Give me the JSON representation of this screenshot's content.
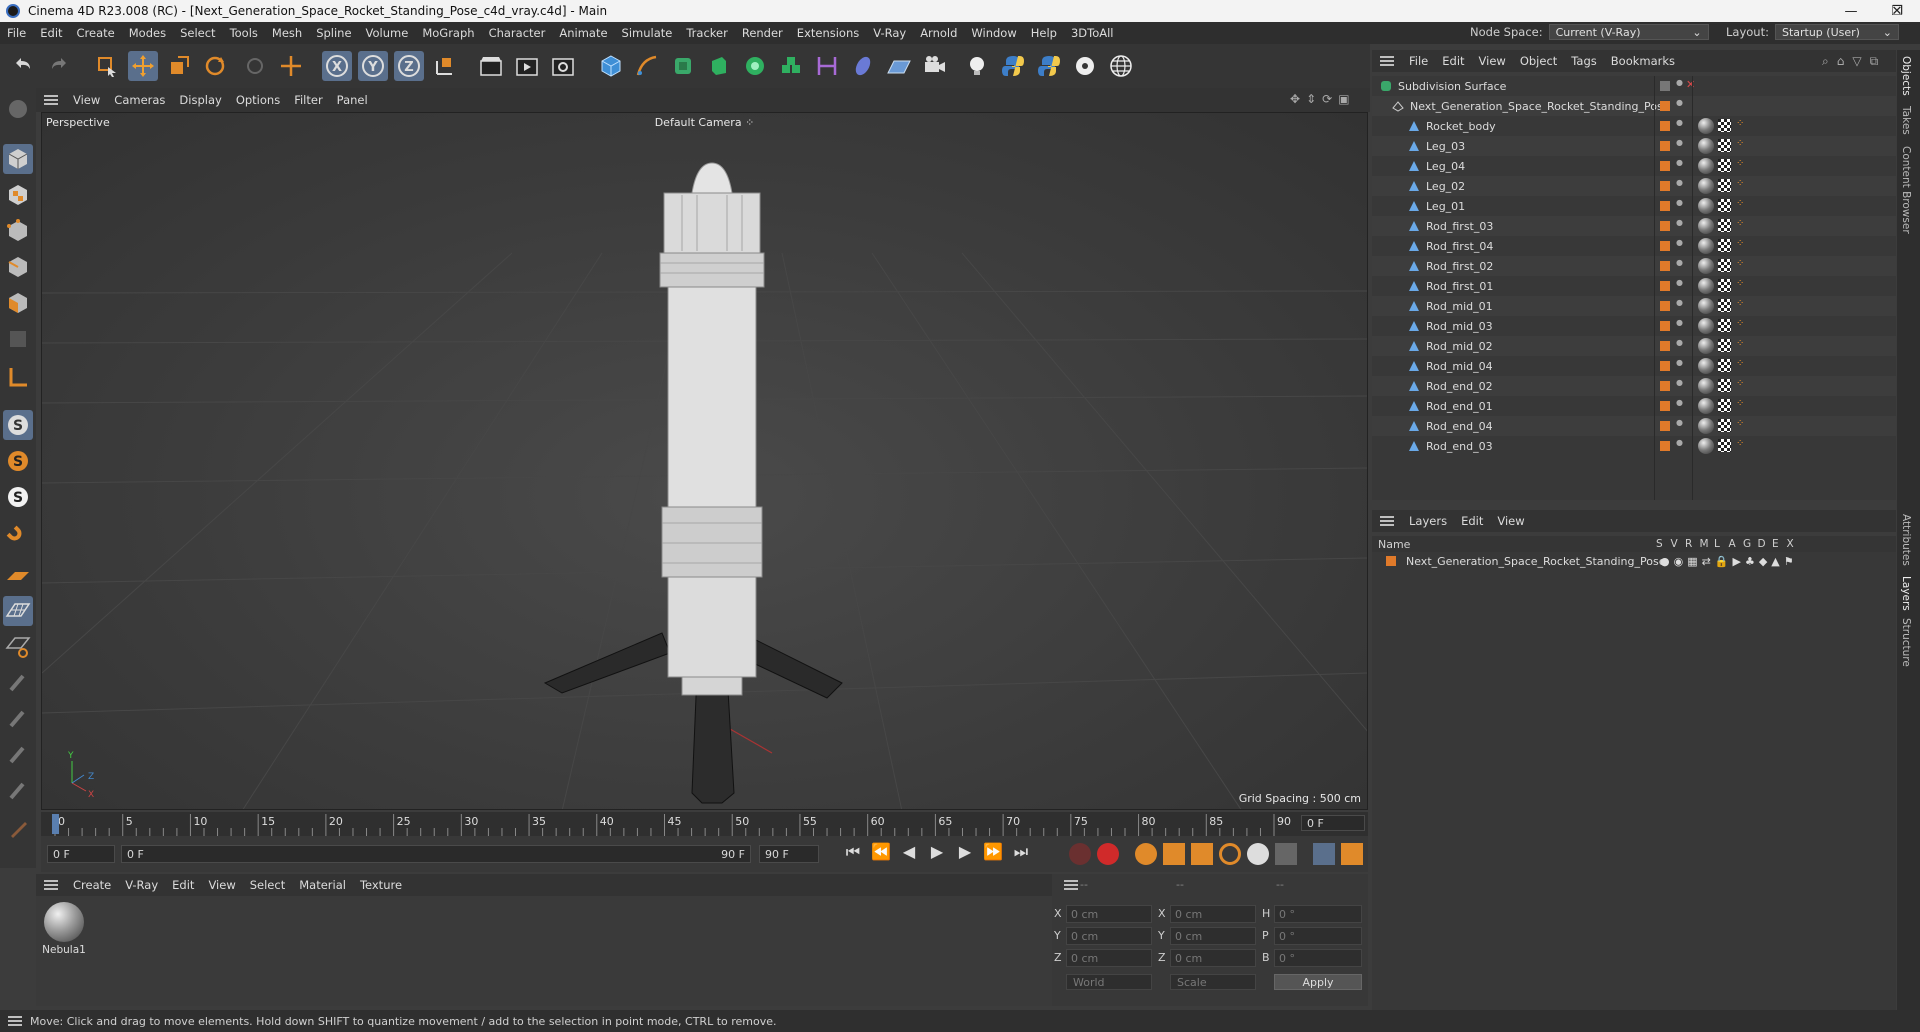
{
  "window": {
    "title": "Cinema 4D R23.008 (RC) - [Next_Generation_Space_Rocket_Standing_Pose_c4d_vray.c4d] - Main",
    "minimize": "—",
    "maximize": "❐",
    "close": "✕"
  },
  "menubar": {
    "items": [
      "File",
      "Edit",
      "Create",
      "Modes",
      "Select",
      "Tools",
      "Mesh",
      "Spline",
      "Volume",
      "MoGraph",
      "Character",
      "Animate",
      "Simulate",
      "Tracker",
      "Render",
      "Extensions",
      "V-Ray",
      "Arnold",
      "Window",
      "Help",
      "3DToAll"
    ],
    "node_space_label": "Node Space:",
    "node_space_value": "Current (V-Ray)",
    "layout_label": "Layout:",
    "layout_value": "Startup (User)"
  },
  "viewport": {
    "menu": [
      "View",
      "Cameras",
      "Display",
      "Options",
      "Filter",
      "Panel"
    ],
    "view_name": "Perspective",
    "camera": "Default Camera",
    "grid_spacing": "Grid Spacing : 500 cm",
    "axis_y": "Y",
    "axis_z": "Z",
    "axis_x": "X"
  },
  "timeline": {
    "ticks": [
      "0",
      "5",
      "10",
      "15",
      "20",
      "25",
      "30",
      "35",
      "40",
      "45",
      "50",
      "55",
      "60",
      "65",
      "70",
      "75",
      "80",
      "85",
      "90"
    ],
    "current_frame": "0 F",
    "start_field": "0 F",
    "range_start": "0 F",
    "range_end": "90 F",
    "end_field": "90 F"
  },
  "materials": {
    "menu": [
      "Create",
      "V-Ray",
      "Edit",
      "View",
      "Select",
      "Material",
      "Texture"
    ],
    "items": [
      {
        "name": "Nebula1"
      }
    ]
  },
  "coordinates": {
    "header_dashes": [
      "--",
      "--",
      "--"
    ],
    "rows": [
      {
        "a": "X",
        "av": "0 cm",
        "b": "X",
        "bv": "0 cm",
        "c": "H",
        "cv": "0 °"
      },
      {
        "a": "Y",
        "av": "0 cm",
        "b": "Y",
        "bv": "0 cm",
        "c": "P",
        "cv": "0 °"
      },
      {
        "a": "Z",
        "av": "0 cm",
        "b": "Z",
        "bv": "0 cm",
        "c": "B",
        "cv": "0 °"
      }
    ],
    "mode_world": "World",
    "mode_scale": "Scale",
    "apply": "Apply"
  },
  "object_manager": {
    "menu": [
      "File",
      "Edit",
      "View",
      "Object",
      "Tags",
      "Bookmarks"
    ],
    "root": "Subdivision Surface",
    "group": "Next_Generation_Space_Rocket_Standing_Pose",
    "children": [
      "Rocket_body",
      "Leg_03",
      "Leg_04",
      "Leg_02",
      "Leg_01",
      "Rod_first_03",
      "Rod_first_04",
      "Rod_first_02",
      "Rod_first_01",
      "Rod_mid_01",
      "Rod_mid_03",
      "Rod_mid_02",
      "Rod_mid_04",
      "Rod_end_02",
      "Rod_end_01",
      "Rod_end_04",
      "Rod_end_03"
    ]
  },
  "layer_manager": {
    "menu": [
      "Layers",
      "Edit",
      "View"
    ],
    "name_header": "Name",
    "flag_headers": [
      "S",
      "V",
      "R",
      "M",
      "L",
      "A",
      "G",
      "D",
      "E",
      "X"
    ],
    "layers": [
      "Next_Generation_Space_Rocket_Standing_Pose"
    ]
  },
  "right_tabs": [
    "Objects",
    "Takes",
    "Content Browser",
    "Attributes",
    "Layers",
    "Structure"
  ],
  "status": "Move: Click and drag to move elements. Hold down SHIFT to quantize movement / add to the selection in point mode, CTRL to remove.",
  "colors": {
    "accent_orange": "#e07a2a",
    "active_blue": "#5a6f8c",
    "tree_icon_blue": "#6aa9e8"
  }
}
